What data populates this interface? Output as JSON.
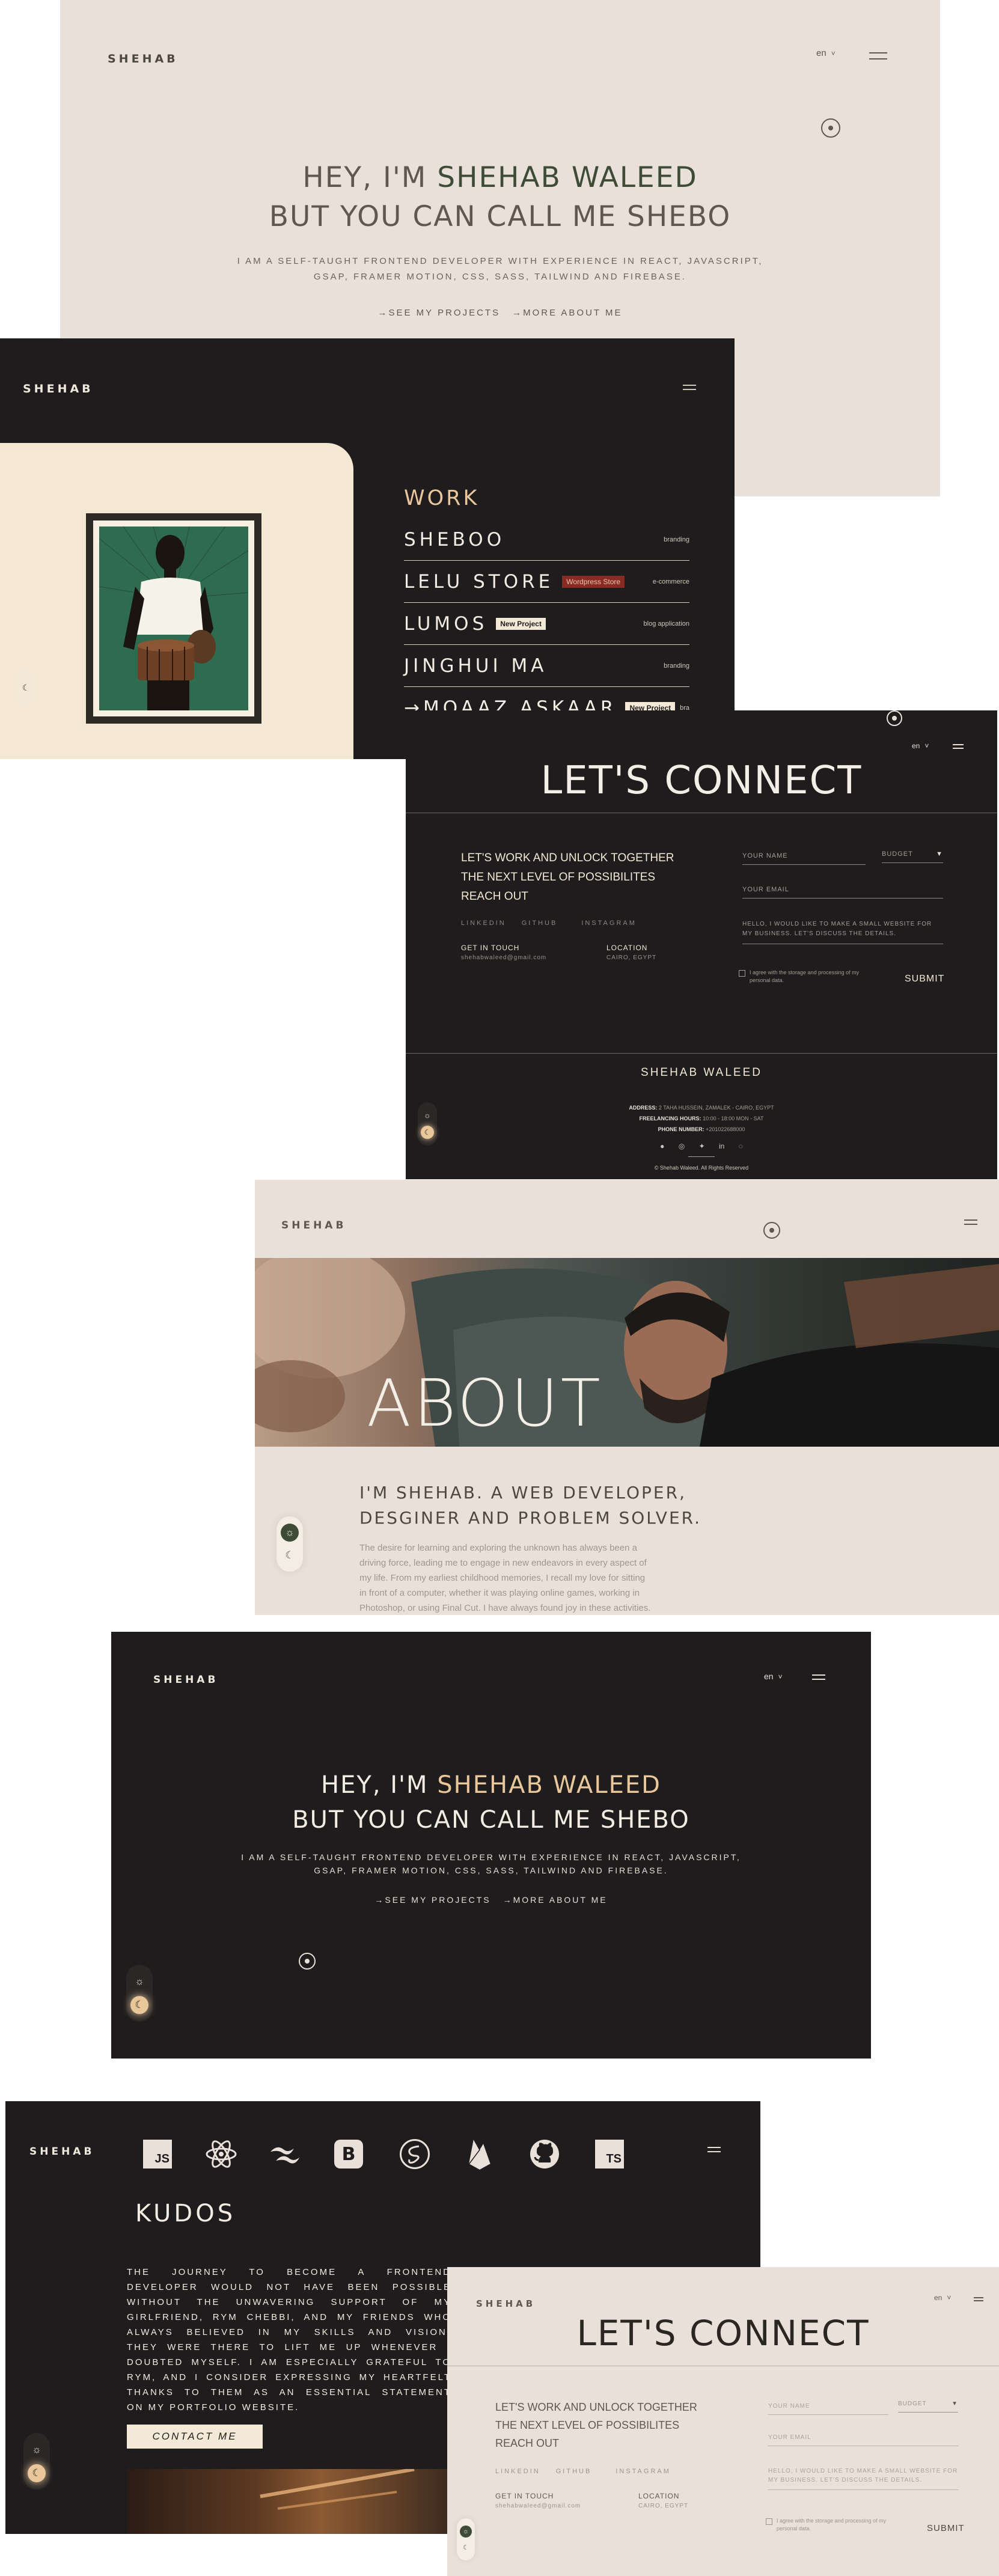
{
  "brand": "SHEHAB",
  "lang": "en",
  "lang_chevron": "˅",
  "hero": {
    "line1_a": "HEY, I'M ",
    "line1_b": "SHEHAB WALEED",
    "line2": "BUT YOU CAN CALL ME SHEBO",
    "sub1": "I AM A SELF-TAUGHT FRONTEND DEVELOPER WITH EXPERIENCE IN REACT, JAVASCRIPT,",
    "sub2": "GSAP, FRAMER MOTION, CSS, SASS, TAILWIND AND FIREBASE.",
    "link_projects": "→SEE MY PROJECTS",
    "link_about": "→MORE ABOUT ME"
  },
  "work": {
    "heading": "WORK",
    "items": [
      {
        "name": "SHEBOO",
        "tag": "",
        "category": "branding"
      },
      {
        "name": "LELU STORE",
        "tag": "Wordpress Store",
        "category": "e-commerce"
      },
      {
        "name": "LUMOS",
        "tag": "New Project",
        "category": "blog application"
      },
      {
        "name": "JINGHUI MA",
        "tag": "",
        "category": "branding"
      },
      {
        "name": "→MOAAZ ASKAAR",
        "tag": "New Project",
        "category": "bra"
      }
    ]
  },
  "connect": {
    "heading": "LET'S CONNECT",
    "intro1": "LET'S WORK AND UNLOCK TOGETHER",
    "intro2": "THE NEXT LEVEL OF POSSIBILITES",
    "intro3": "REACH OUT",
    "socials": [
      "LINKEDIN",
      "GITHUB",
      "INSTAGRAM"
    ],
    "get_in_touch": "GET IN TOUCH",
    "email": "shehabwaleed@gmail.com",
    "location_label": "LOCATION",
    "location": "CAIRO, EGYPT",
    "name_placeholder": "YOUR NAME",
    "budget": "BUDGET",
    "budget_chevron": "▼",
    "email_placeholder": "YOUR EMAIL",
    "message1": "HELLO, I WOULD LIKE TO MAKE A SMALL WEBSITE FOR",
    "message2": "MY BUSINESS. LET'S DISCUSS THE DETAILS.",
    "consent1": "I agree with the storage and processing of my",
    "consent2": "personal data.",
    "submit": "SUBMIT"
  },
  "footer": {
    "name": "SHEHAB WALEED",
    "address_label": "ADDRESS:",
    "address": "2 TAHA HUSSEIN, ZAMALEK - CAIRO, EGYPT",
    "hours_label": "FREELANCING HOURS:",
    "hours": "10:00 - 18:00 MON - SAT",
    "phone_label": "PHONE NUMBER:",
    "phone": "+201022688000",
    "social_icons": [
      "●",
      "◎",
      "✦",
      "in",
      "◌"
    ],
    "copyright": "© Shehab Waleed. All Rights Reserved"
  },
  "about": {
    "heading": "ABOUT",
    "title1": "I'M SHEHAB. A WEB DEVELOPER,",
    "title2": "DESGINER AND PROBLEM SOLVER.",
    "p1": "The desire for learning and exploring the unknown has always been a",
    "p2": "driving force, leading me to engage in new endeavors in every aspect of",
    "p3": "my life. From my earliest childhood memories, I recall my love for sitting",
    "p4": "in front of a computer, whether it was playing online games, working in",
    "p5": "Photoshop, or using Final Cut. I have always found joy in these activities."
  },
  "kudos": {
    "heading": "KUDOS",
    "lines": [
      "THE JOURNEY TO BECOME A FRONTEND",
      "DEVELOPER WOULD NOT HAVE BEEN POSSIBLE",
      "WITHOUT THE UNWAVERING SUPPORT OF MY",
      "GIRLFRIEND, RYM CHEBBI, AND MY FRIENDS WHO",
      "ALWAYS BELIEVED IN MY SKILLS AND VISION.",
      "THEY WERE THERE TO LIFT ME UP WHENEVER I",
      "DOUBTED MYSELF. I AM ESPECIALLY GRATEFUL TO",
      "RYM, AND I CONSIDER EXPRESSING MY HEARTFELT",
      "THANKS TO THEM AS AN ESSENTIAL STATEMENT",
      "ON MY PORTFOLIO WEBSITE."
    ],
    "contact_button": "CONTACT ME",
    "tech": {
      "js": "JS",
      "ts": "TS",
      "bootstrap": "B"
    }
  },
  "toggle": {
    "sun": "☼",
    "moon": "☾"
  },
  "colors": {
    "beige": "#e9e1d9",
    "dark": "#1e1c1c",
    "green": "#3e4b37",
    "gold": "#e9c79b",
    "cream": "#f3e9d6"
  }
}
